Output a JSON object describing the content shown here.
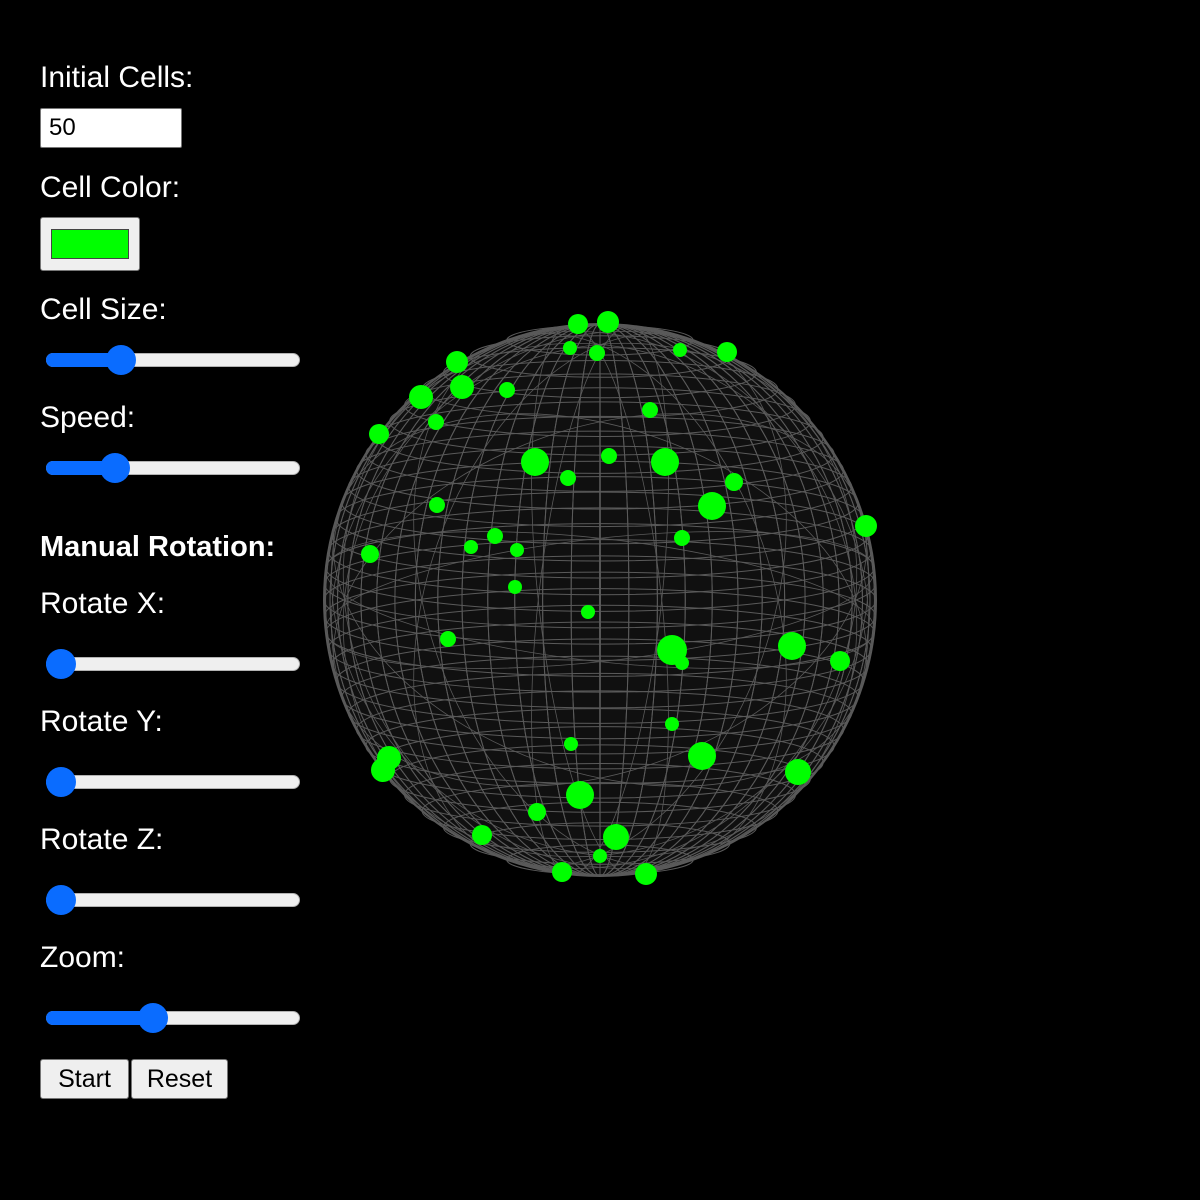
{
  "controls": {
    "initial_cells_label": "Initial Cells:",
    "initial_cells_value": "50",
    "cell_color_label": "Cell Color:",
    "cell_color_value": "#00ff00",
    "cell_size_label": "Cell Size:",
    "cell_size_level": 0.27,
    "speed_label": "Speed:",
    "speed_level": 0.24,
    "manual_rotation_title": "Manual Rotation:",
    "rotate_x_label": "Rotate X:",
    "rotate_x_level": 0,
    "rotate_y_label": "Rotate Y:",
    "rotate_y_level": 0,
    "rotate_z_label": "Rotate Z:",
    "rotate_z_level": 0,
    "zoom_label": "Zoom:",
    "zoom_level": 0.41,
    "start_label": "Start",
    "reset_label": "Reset"
  },
  "colors": {
    "background": "#000000",
    "accent": "#0a6cff",
    "sphere_wire": "#5a5a5a",
    "cell": "#00ff00"
  },
  "icons": {
    "sphere": "wireframe-sphere",
    "cell": "cell-dot"
  }
}
